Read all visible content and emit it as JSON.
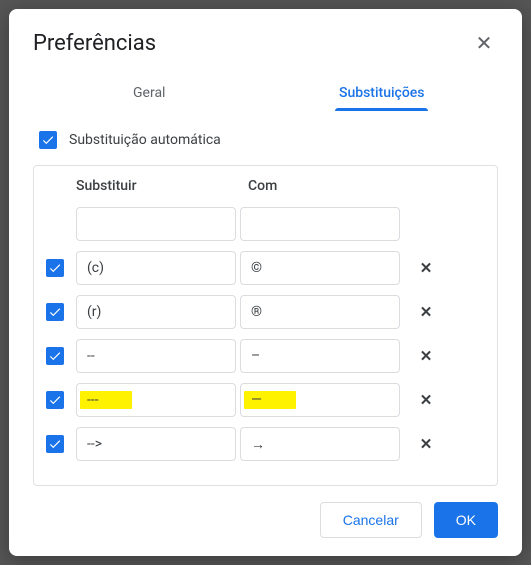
{
  "dialog": {
    "title": "Preferências",
    "close_glyph": "✕"
  },
  "tabs": {
    "general": "Geral",
    "substitutions": "Substituições"
  },
  "auto": {
    "label": "Substituição automática"
  },
  "columns": {
    "replace": "Substituir",
    "with": "Com"
  },
  "rows": [
    {
      "enabled": false,
      "replace": "",
      "with": "",
      "deletable": false,
      "highlight": false
    },
    {
      "enabled": true,
      "replace": "(c)",
      "with": "©",
      "deletable": true,
      "highlight": false
    },
    {
      "enabled": true,
      "replace": "(r)",
      "with": "®",
      "deletable": true,
      "highlight": false
    },
    {
      "enabled": true,
      "replace": "--",
      "with": "–",
      "deletable": true,
      "highlight": false
    },
    {
      "enabled": true,
      "replace": "---",
      "with": "—",
      "deletable": true,
      "highlight": true
    },
    {
      "enabled": true,
      "replace": "-->",
      "with": "→",
      "deletable": true,
      "highlight": false
    }
  ],
  "footer": {
    "cancel": "Cancelar",
    "ok": "OK"
  },
  "icons": {
    "delete_glyph": "✕"
  }
}
